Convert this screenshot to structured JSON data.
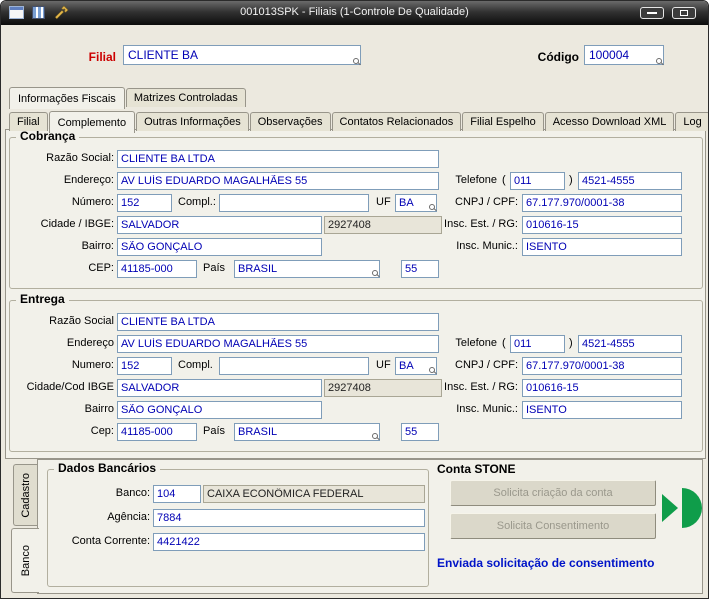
{
  "window": {
    "title": "001013SPK - Filiais (1-Controle De Qualidade)"
  },
  "header": {
    "filial_label": "Filial",
    "filial_value": "CLIENTE BA",
    "codigo_label": "Código",
    "codigo_value": "100004"
  },
  "upper_tabs": {
    "tab1": "Informações Fiscais",
    "tab2": "Matrizes Controladas"
  },
  "main_tabs": {
    "active": "Complemento",
    "items": [
      {
        "label": "Filial"
      },
      {
        "label": "Complemento"
      },
      {
        "label": "Outras Informações"
      },
      {
        "label": "Observações"
      },
      {
        "label": "Contatos Relacionados"
      },
      {
        "label": "Filial Espelho"
      },
      {
        "label": "Acesso Download XML"
      },
      {
        "label": "Log"
      }
    ]
  },
  "cobranca": {
    "title": "Cobrança",
    "labels": {
      "razao_social": "Razão Social:",
      "endereco": "Endereço:",
      "numero": "Número:",
      "compl": "Compl.:",
      "uf": "UF",
      "cidade": "Cidade / IBGE:",
      "bairro": "Bairro:",
      "cep": "CEP:",
      "pais": "País",
      "telefone": "Telefone",
      "paren_open": "(",
      "paren_close": ")",
      "cnpj_cpf": "CNPJ / CPF:",
      "insc_est": "Insc. Est. / RG:",
      "insc_mun": "Insc. Munic.:"
    },
    "values": {
      "razao_social": "CLIENTE BA LTDA",
      "endereco": "AV LUÍS EDUARDO MAGALHÃES 55",
      "numero": "152",
      "complemento": "",
      "uf": "BA",
      "cidade": "SALVADOR",
      "cod_ibge": "2927408",
      "bairro": "SÃO GONÇALO",
      "cep": "41185-000",
      "pais": "BRASIL",
      "pais_codigo": "55",
      "ddd": "011",
      "telefone": "4521-4555",
      "cnpj_cpf": "67.177.970/0001-38",
      "insc_est_rg": "010616-15",
      "insc_municipal": "ISENTO"
    }
  },
  "entrega": {
    "title": "Entrega",
    "labels": {
      "razao_social": "Razão Social",
      "endereco": "Endereço",
      "numero": "Numero:",
      "compl": "Compl.",
      "uf": "UF",
      "cidade": "Cidade/Cod IBGE",
      "bairro": "Bairro",
      "cep": "Cep:",
      "pais": "País",
      "telefone": "Telefone",
      "paren_open": "(",
      "paren_close": ")",
      "cnpj_cpf": "CNPJ / CPF:",
      "insc_est": "Insc. Est. / RG:",
      "insc_mun": "Insc. Munic.:"
    },
    "values": {
      "razao_social": "CLIENTE BA LTDA",
      "endereco": "AV LUÍS EDUARDO MAGALHÃES 55",
      "numero": "152",
      "complemento": "",
      "uf": "BA",
      "cidade": "SALVADOR",
      "cod_ibge": "2927408",
      "bairro": "SÃO GONÇALO",
      "cep": "41185-000",
      "pais": "BRASIL",
      "pais_codigo": "55",
      "ddd": "011",
      "telefone": "4521-4555",
      "cnpj_cpf": "67.177.970/0001-38",
      "insc_est_rg": "010616-15",
      "insc_municipal": "ISENTO"
    }
  },
  "bottom": {
    "side_tabs": {
      "cadastro": "Cadastro",
      "banco": "Banco",
      "active": "Banco"
    },
    "dados_bancarios": {
      "title": "Dados Bancários",
      "labels": {
        "banco": "Banco:",
        "agencia": "Agência:",
        "conta": "Conta Corrente:"
      },
      "values": {
        "banco_codigo": "104",
        "banco_nome": "CAIXA ECONÔMICA FEDERAL",
        "agencia": "7884",
        "conta_corrente": "4421422"
      }
    },
    "conta_stone": {
      "title": "Conta STONE",
      "solicita_criacao_button": "Solicita criação da conta",
      "solicita_consentimento_button": "Solicita Consentimento",
      "status_message": "Enviada solicitação de consentimento"
    }
  },
  "colors": {
    "field_text": "#0000b4",
    "filial_label": "#cc0000",
    "status_text": "#0014c8",
    "stone_green": "#0f9d4a"
  }
}
